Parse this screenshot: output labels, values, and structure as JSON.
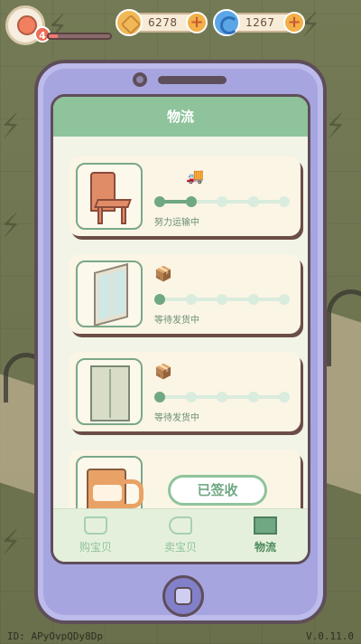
{
  "hud": {
    "level": "4",
    "xp_progress": 0.15,
    "coins": "6278",
    "shells": "1267",
    "coin_icon": "coin-icon",
    "shell_icon": "shell-icon"
  },
  "logistics": {
    "title": "物流",
    "orders": [
      {
        "item": "chair",
        "status": "努力运输中",
        "state_icon": "truck-icon",
        "progress_step": 2,
        "total_steps": 5
      },
      {
        "item": "window",
        "status": "等待发货中",
        "state_icon": "package-icon",
        "progress_step": 1,
        "total_steps": 5
      },
      {
        "item": "cabinet",
        "status": "等待发货中",
        "state_icon": "package-icon",
        "progress_step": 1,
        "total_steps": 5
      },
      {
        "item": "mug",
        "action_label": "已签收"
      }
    ]
  },
  "nav": {
    "tabs": [
      {
        "label": "购宝贝",
        "icon": "shopping-bag-icon",
        "active": false
      },
      {
        "label": "卖宝贝",
        "icon": "price-tag-icon",
        "active": false
      },
      {
        "label": "物流",
        "icon": "box-icon",
        "active": true
      }
    ]
  },
  "footer": {
    "id": "ID: APyOvpQDy8Dp",
    "version": "V.0.11.0"
  },
  "colors": {
    "header": "#8fc39b",
    "phone_body": "#a7a5e0",
    "progress_active": "#6fa883",
    "progress_inactive": "#d9ecdd"
  }
}
